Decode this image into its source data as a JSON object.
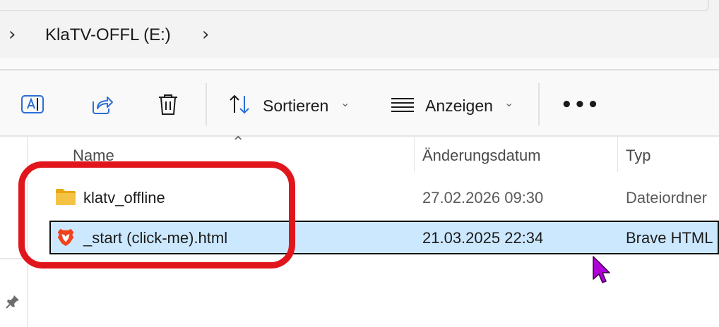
{
  "breadcrumb": {
    "drive_label": "KlaTV-OFFL (E:)"
  },
  "toolbar": {
    "sort_label": "Sortieren",
    "view_label": "Anzeigen",
    "more_label": "•••",
    "icons": [
      "rename-icon",
      "share-icon",
      "delete-icon",
      "sort-icon",
      "view-icon"
    ]
  },
  "columns": {
    "name": "Name",
    "date": "Änderungsdatum",
    "type": "Typ"
  },
  "files": [
    {
      "name": "klatv_offline",
      "date": "27.02.2026 09:30",
      "type": "Dateiordner",
      "icon": "folder-icon"
    },
    {
      "name": "_start (click-me).html",
      "date": "21.03.2025 22:34",
      "type": "Brave HTML",
      "icon": "brave-icon",
      "selected": true
    }
  ],
  "colors": {
    "selection": "#cce8ff",
    "highlight_ring": "#e1161c",
    "cursor": "#b000d8",
    "folder": "#f5c344",
    "brave": "#f0421c"
  }
}
